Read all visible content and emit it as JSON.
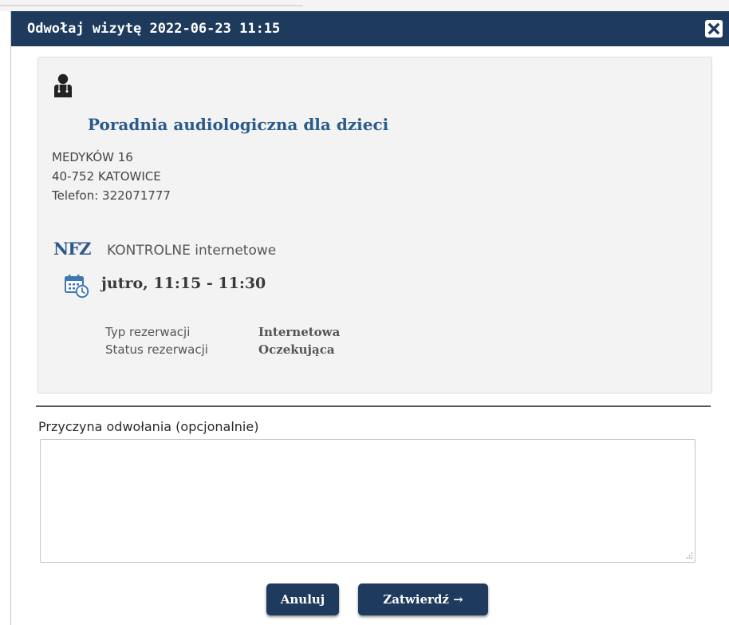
{
  "dialog": {
    "title": "Odwołaj wizytę 2022-06-23 11:15",
    "close_icon": "close-icon"
  },
  "clinic": {
    "icon": "doctor-icon",
    "name": "Poradnia audiologiczna dla dzieci",
    "street": "MEDYKÓW 16",
    "city": "40-752 KATOWICE",
    "phone": "Telefon: 322071777"
  },
  "visit": {
    "nfz_label": "NFZ",
    "type": "KONTROLNE internetowe",
    "calendar_icon": "calendar-clock-icon",
    "time": "jutro, 11:15 - 11:30",
    "details": [
      {
        "label": "Typ rezerwacji",
        "value": "Internetowa"
      },
      {
        "label": "Status rezerwacji",
        "value": "Oczekująca"
      }
    ]
  },
  "form": {
    "reason_label": "Przyczyna odwołania (opcjonalnie)",
    "reason_value": ""
  },
  "buttons": {
    "cancel": "Anuluj",
    "confirm": "Zatwierdź →"
  },
  "colors": {
    "header_bg": "#1e3a5c",
    "accent": "#2c5a8c",
    "card_bg": "#f3f3f3"
  }
}
